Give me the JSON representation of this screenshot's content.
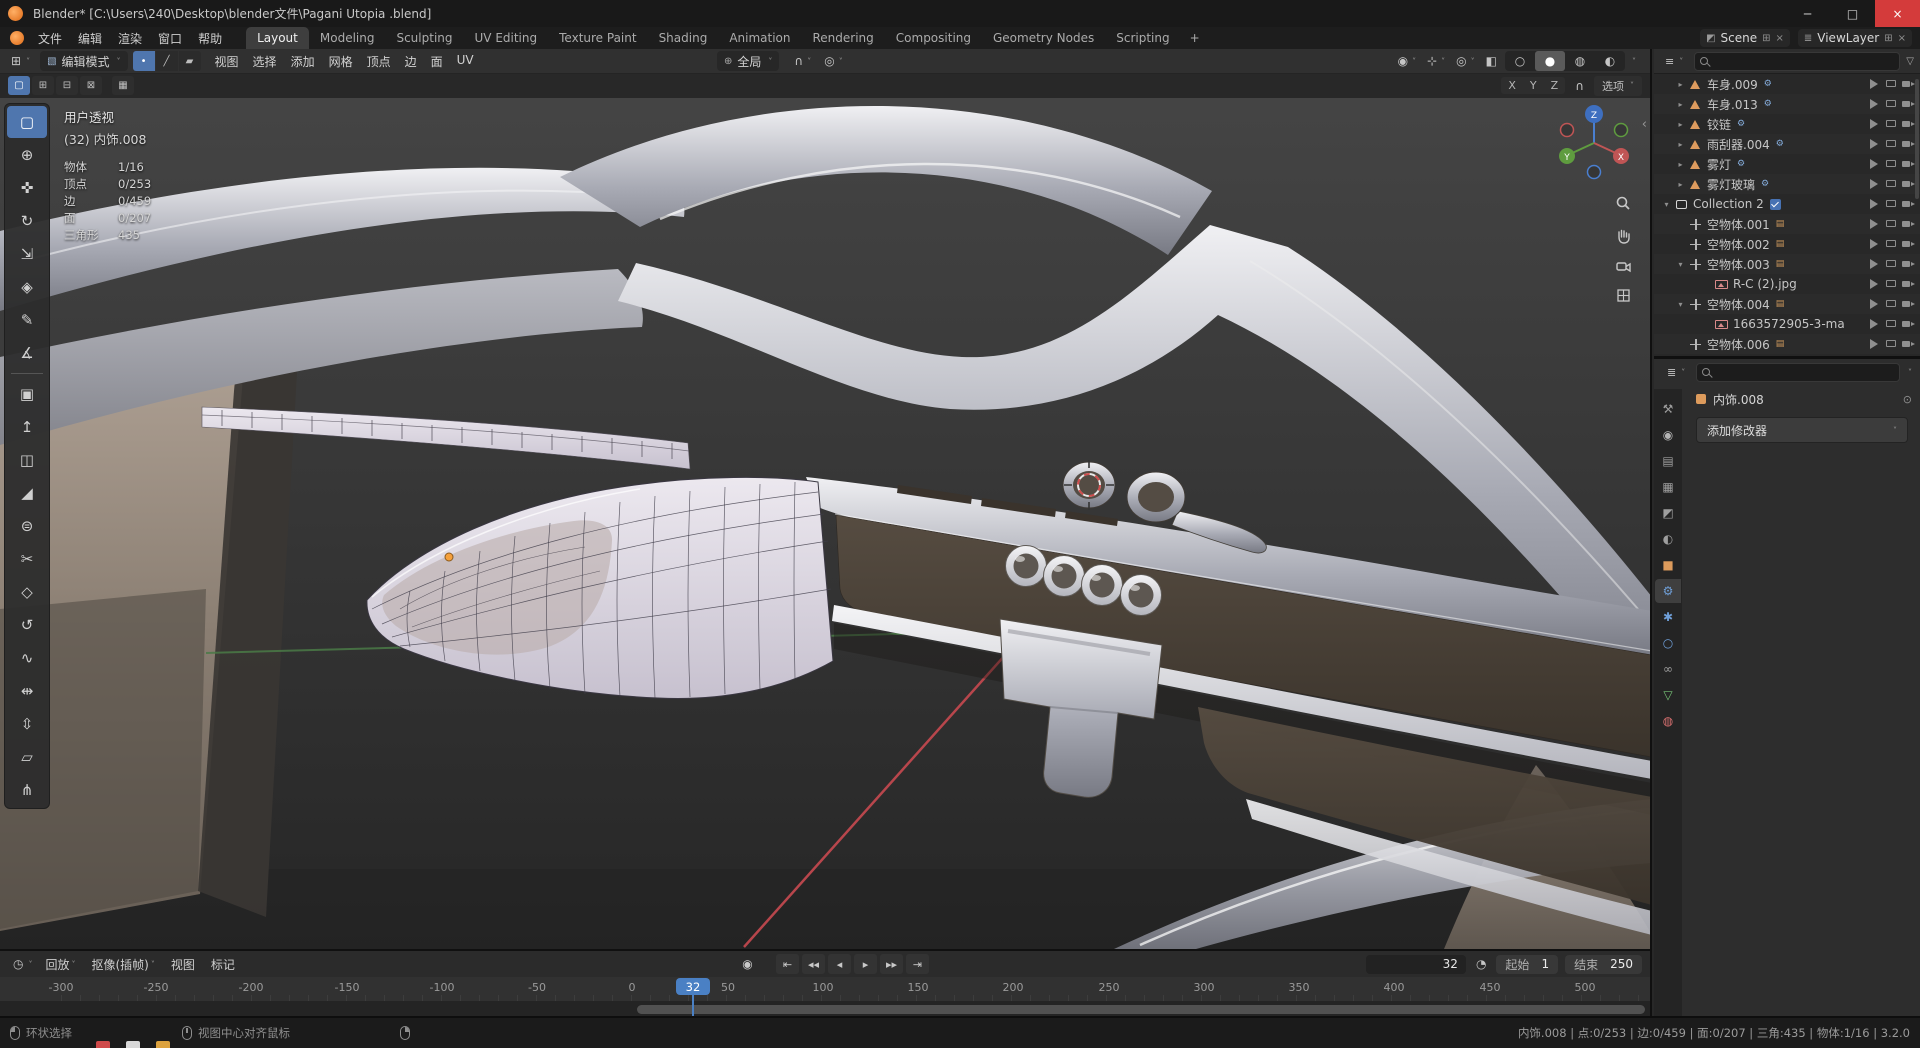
{
  "ui": {
    "caret": "˅",
    "collapse_left": "‹",
    "window_min": "─",
    "window_max": "□",
    "window_close": "×"
  },
  "window": {
    "title": "Blender* [C:\\Users\\240\\Desktop\\blender文件\\Pagani Utopia .blend]"
  },
  "topbar": {
    "menus": [
      "文件",
      "编辑",
      "渲染",
      "窗口",
      "帮助"
    ],
    "workspaces": [
      {
        "label": "Layout",
        "state": "active"
      },
      {
        "label": "Modeling"
      },
      {
        "label": "Sculpting"
      },
      {
        "label": "UV Editing"
      },
      {
        "label": "Texture Paint"
      },
      {
        "label": "Shading"
      },
      {
        "label": "Animation"
      },
      {
        "label": "Rendering"
      },
      {
        "label": "Compositing"
      },
      {
        "label": "Geometry Nodes"
      },
      {
        "label": "Scripting"
      }
    ],
    "add_workspace": "+",
    "scene_icon": "◩",
    "scene": "Scene",
    "scene_new": "⊞",
    "scene_close": "×",
    "viewlayer_icon": "≣",
    "viewlayer": "ViewLayer",
    "viewlayer_new": "⊞",
    "viewlayer_close": "×"
  },
  "viewport": {
    "editor_icon": "⊞",
    "mode_icon": "▧",
    "mode": "编辑模式",
    "select_modes": [
      {
        "glyph": "•",
        "name": "vertex-select",
        "state": "active"
      },
      {
        "glyph": "╱",
        "name": "edge-select"
      },
      {
        "glyph": "▰",
        "name": "face-select"
      }
    ],
    "menus": [
      "视图",
      "选择",
      "添加",
      "网格",
      "顶点",
      "边",
      "面",
      "UV"
    ],
    "orientation_icon": "⊕",
    "orientation": "全局",
    "snap_icon": "∩",
    "proportional_icon": "◎",
    "right_icons": [
      {
        "glyph": "◉",
        "name": "show-object-types",
        "caret": true
      },
      {
        "glyph": "⊹",
        "name": "gizmos",
        "caret": true
      },
      {
        "glyph": "◎",
        "name": "overlays",
        "caret": true
      },
      {
        "glyph": "◧",
        "name": "toggle-xray"
      }
    ],
    "shading_modes": [
      {
        "glyph": "○",
        "name": "wireframe-shading"
      },
      {
        "glyph": "●",
        "name": "solid-shading",
        "state": "active"
      },
      {
        "glyph": "◍",
        "name": "material-preview-shading"
      },
      {
        "glyph": "◐",
        "name": "rendered-shading"
      }
    ],
    "tool_options": {
      "select_option_icons": [
        {
          "glyph": "▢",
          "name": "select-set",
          "state": "active"
        },
        {
          "glyph": "⊞",
          "name": "select-extend"
        },
        {
          "glyph": "⊟",
          "name": "select-subtract"
        },
        {
          "glyph": "⊠",
          "name": "select-intersect"
        }
      ],
      "grid_icon": "▦",
      "mirror_axes": [
        {
          "label": "X"
        },
        {
          "label": "Y"
        },
        {
          "label": "Z"
        }
      ],
      "snap_icon": "∩",
      "options": "选项"
    },
    "overlay": {
      "view_label": "用户透视",
      "object_label": "(32) 内饰.008",
      "stats": [
        {
          "label": "物体",
          "value": "1/16"
        },
        {
          "label": "顶点",
          "value": "0/253"
        },
        {
          "label": "边",
          "value": "0/459"
        },
        {
          "label": "面",
          "value": "0/207"
        },
        {
          "label": "三角形",
          "value": "435"
        }
      ]
    },
    "gizmo": {
      "x": "X",
      "y": "Y",
      "z": "Z"
    }
  },
  "toolbar": {
    "tools": [
      {
        "glyph": "▢",
        "name": "select-box-tool",
        "state": "active"
      },
      {
        "glyph": "⊕",
        "name": "cursor-tool"
      },
      {
        "glyph": "✜",
        "name": "move-tool"
      },
      {
        "glyph": "↻",
        "name": "rotate-tool"
      },
      {
        "glyph": "⇲",
        "name": "scale-tool"
      },
      {
        "glyph": "◈",
        "name": "transform-tool"
      },
      {
        "glyph": "✎",
        "name": "annotate-tool"
      },
      {
        "glyph": "∡",
        "name": "measure-tool"
      },
      {
        "glyph": "▣",
        "name": "add-cube-tool",
        "sep": true
      },
      {
        "glyph": "↥",
        "name": "extrude-region-tool"
      },
      {
        "glyph": "◫",
        "name": "inset-faces-tool"
      },
      {
        "glyph": "◢",
        "name": "bevel-tool"
      },
      {
        "glyph": "⊜",
        "name": "loop-cut-tool"
      },
      {
        "glyph": "✂",
        "name": "knife-tool"
      },
      {
        "glyph": "◇",
        "name": "poly-build-tool"
      },
      {
        "glyph": "↺",
        "name": "spin-tool"
      },
      {
        "glyph": "∿",
        "name": "smooth-tool"
      },
      {
        "glyph": "⇹",
        "name": "edge-slide-tool"
      },
      {
        "glyph": "⇳",
        "name": "shrink-fatten-tool"
      },
      {
        "glyph": "▱",
        "name": "shear-tool"
      },
      {
        "glyph": "⋔",
        "name": "rip-region-tool"
      }
    ]
  },
  "outliner": {
    "editor_icon": "≡",
    "filter_icon": "▽",
    "rows": [
      {
        "exp": "▸",
        "icon": "mesh",
        "label": "车身.009",
        "indent": "d1",
        "badge": "⚙",
        "badge_cls": "b-mod"
      },
      {
        "exp": "▸",
        "icon": "mesh",
        "label": "车身.013",
        "indent": "d1",
        "badge": "⚙",
        "badge_cls": "b-mod"
      },
      {
        "exp": "▸",
        "icon": "mesh",
        "label": "铰链",
        "indent": "d1",
        "badge": "⚙",
        "badge_cls": "b-mod"
      },
      {
        "exp": "▸",
        "icon": "mesh",
        "label": "雨刮器.004",
        "indent": "d1",
        "badge": "⚙",
        "badge_cls": "b-mod"
      },
      {
        "exp": "▸",
        "icon": "mesh",
        "label": "雾灯",
        "indent": "d1",
        "badge": "⚙",
        "badge_cls": "b-mod"
      },
      {
        "exp": "▸",
        "icon": "mesh",
        "label": "雾灯玻璃",
        "indent": "d1",
        "badge": "⚙",
        "badge_cls": "b-mod"
      },
      {
        "exp": "▾",
        "icon": "collection",
        "label": "Collection 2",
        "indent": "d0",
        "check": true
      },
      {
        "exp": "",
        "icon": "empty",
        "label": "空物体.001",
        "indent": "d1",
        "badge": "▤",
        "badge_cls": "b-img"
      },
      {
        "exp": "",
        "icon": "empty",
        "label": "空物体.002",
        "indent": "d1",
        "badge": "▤",
        "badge_cls": "b-img"
      },
      {
        "exp": "▾",
        "icon": "empty",
        "label": "空物体.003",
        "indent": "d1",
        "badge": "▤",
        "badge_cls": "b-img"
      },
      {
        "exp": "",
        "icon": "image",
        "label": "R-C (2).jpg",
        "indent": "d2"
      },
      {
        "exp": "▾",
        "icon": "empty",
        "label": "空物体.004",
        "indent": "d1",
        "badge": "▤",
        "badge_cls": "b-img"
      },
      {
        "exp": "",
        "icon": "image",
        "label": "1663572905-3-ma",
        "indent": "d2"
      },
      {
        "exp": "",
        "icon": "empty",
        "label": "空物体.006",
        "indent": "d1",
        "badge": "▤",
        "badge_cls": "b-img"
      }
    ]
  },
  "properties": {
    "editor_icon": "≣",
    "filter_icon": "▽",
    "tabs": [
      {
        "glyph": "⚒",
        "name": "tool-tab"
      },
      {
        "glyph": "◉",
        "name": "render-tab",
        "cls": "c-gray"
      },
      {
        "glyph": "▤",
        "name": "output-tab"
      },
      {
        "glyph": "▦",
        "name": "view-layer-tab"
      },
      {
        "glyph": "◩",
        "name": "scene-tab"
      },
      {
        "glyph": "◐",
        "name": "world-tab"
      },
      {
        "glyph": "■",
        "name": "object-tab",
        "cls": "c-orange"
      },
      {
        "glyph": "⚙",
        "name": "modifiers-tab",
        "cls": "c-blue",
        "state": "active"
      },
      {
        "glyph": "✱",
        "name": "particles-tab",
        "cls": "c-blue"
      },
      {
        "glyph": "○",
        "name": "physics-tab",
        "cls": "c-blue"
      },
      {
        "glyph": "∞",
        "name": "constraints-tab"
      },
      {
        "glyph": "▽",
        "name": "object-data-tab",
        "cls": "c-green"
      },
      {
        "glyph": "◍",
        "name": "material-tab",
        "cls": "c-red"
      }
    ],
    "breadcrumb": "内饰.008",
    "pin_icon": "⊙",
    "add_modifier": "添加修改器"
  },
  "timeline": {
    "editor_icon": "◷",
    "menus": [
      {
        "label": "回放",
        "caret": true
      },
      {
        "label": "抠像(插帧)",
        "caret": true
      },
      {
        "label": "视图"
      },
      {
        "label": "标记"
      }
    ],
    "autokey_icon": "◉",
    "transport": [
      {
        "glyph": "⇤",
        "name": "jump-to-start-button"
      },
      {
        "glyph": "◂◂",
        "name": "previous-keyframe-button"
      },
      {
        "glyph": "◂",
        "name": "play-reverse-button"
      },
      {
        "glyph": "▸",
        "name": "play-button"
      },
      {
        "glyph": "▸▸",
        "name": "next-keyframe-button"
      },
      {
        "glyph": "⇥",
        "name": "jump-to-end-button"
      }
    ],
    "frame_current": "32",
    "preview_icon": "◔",
    "start_label": "起始",
    "start_value": "1",
    "end_label": "结束",
    "end_value": "250",
    "ruler": [
      "-300",
      "-250",
      "-200",
      "-150",
      "-100",
      "-50",
      "0",
      "50",
      "100",
      "150",
      "200",
      "250",
      "300",
      "350",
      "400",
      "450",
      "500"
    ],
    "playhead": "32"
  },
  "statusbar": {
    "hints": [
      {
        "icon": "left",
        "label": "环状选择"
      },
      {
        "icon": "mid",
        "label": "视图中心对齐鼠标"
      },
      {
        "icon": "right",
        "label": ""
      }
    ],
    "taskbar_peek": [
      {
        "color": "#cf4a4a"
      },
      {
        "color": "#d8d8d8"
      },
      {
        "color": "#dca23e"
      }
    ],
    "stats": "内饰.008 | 点:0/253 | 边:0/459 | 面:0/207 | 三角:435 | 物体:1/16 | 3.2.0"
  }
}
